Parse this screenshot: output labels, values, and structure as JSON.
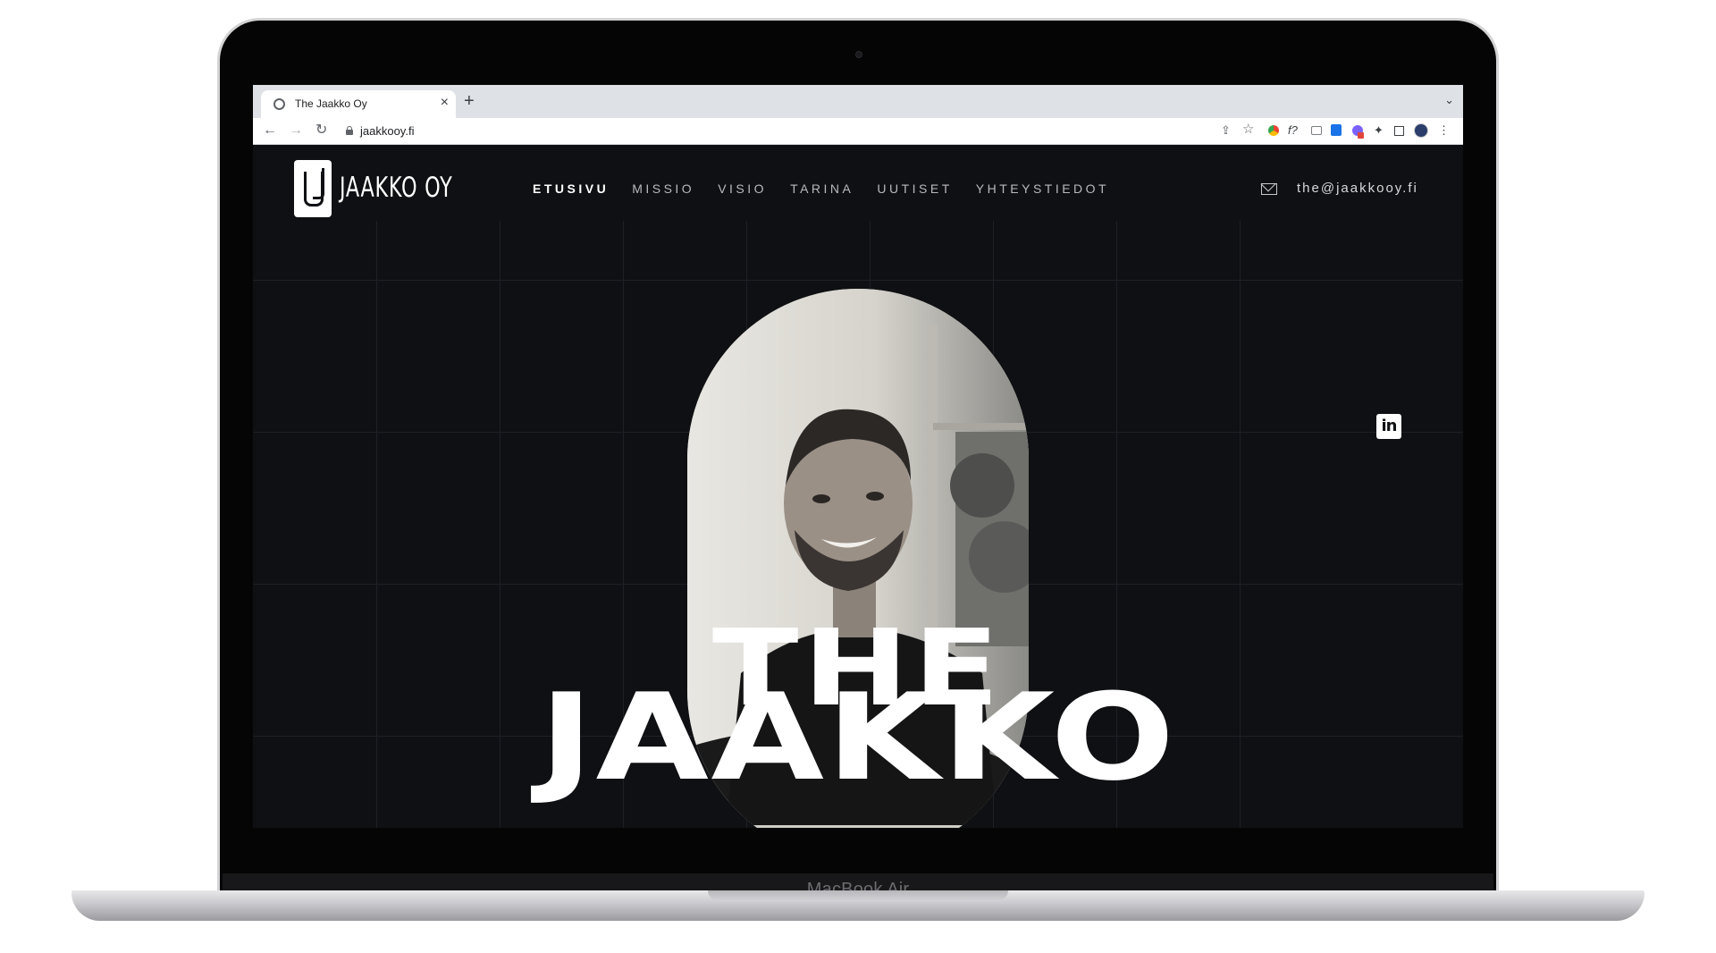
{
  "device": {
    "model_label": "MacBook Air"
  },
  "browser": {
    "tab_title": "The Jaakko Oy",
    "url": "jaakkooy.fi",
    "new_tab_symbol": "+",
    "close_symbol": "×",
    "tab_menu_symbol": "⌄",
    "back_symbol": "←",
    "forward_symbol": "→",
    "reload_symbol": "↻",
    "share_symbol": "⇪",
    "bookmark_symbol": "☆",
    "fx_symbol": "f?",
    "puzzle_symbol": "✦",
    "menu_symbol": "⋮"
  },
  "site": {
    "logo_text": "JAAKKO OY",
    "nav": [
      {
        "label": "ETUSIVU",
        "active": true
      },
      {
        "label": "MISSIO",
        "active": false
      },
      {
        "label": "VISIO",
        "active": false
      },
      {
        "label": "TARINA",
        "active": false
      },
      {
        "label": "UUTISET",
        "active": false
      },
      {
        "label": "YHTEYSTIEDOT",
        "active": false
      }
    ],
    "email": "the@jaakkooy.fi",
    "linkedin_label": "in",
    "hero": {
      "line1": "THE",
      "line2": "JAAKKO"
    }
  },
  "colors": {
    "site_background": "#0f1013",
    "grid_line": "#1e2026",
    "text_primary": "#ffffff",
    "nav_text": "#b9b9bd"
  },
  "icons": [
    "globe-icon",
    "lock-icon",
    "mail-icon",
    "linkedin-icon",
    "logo-mark-icon"
  ]
}
